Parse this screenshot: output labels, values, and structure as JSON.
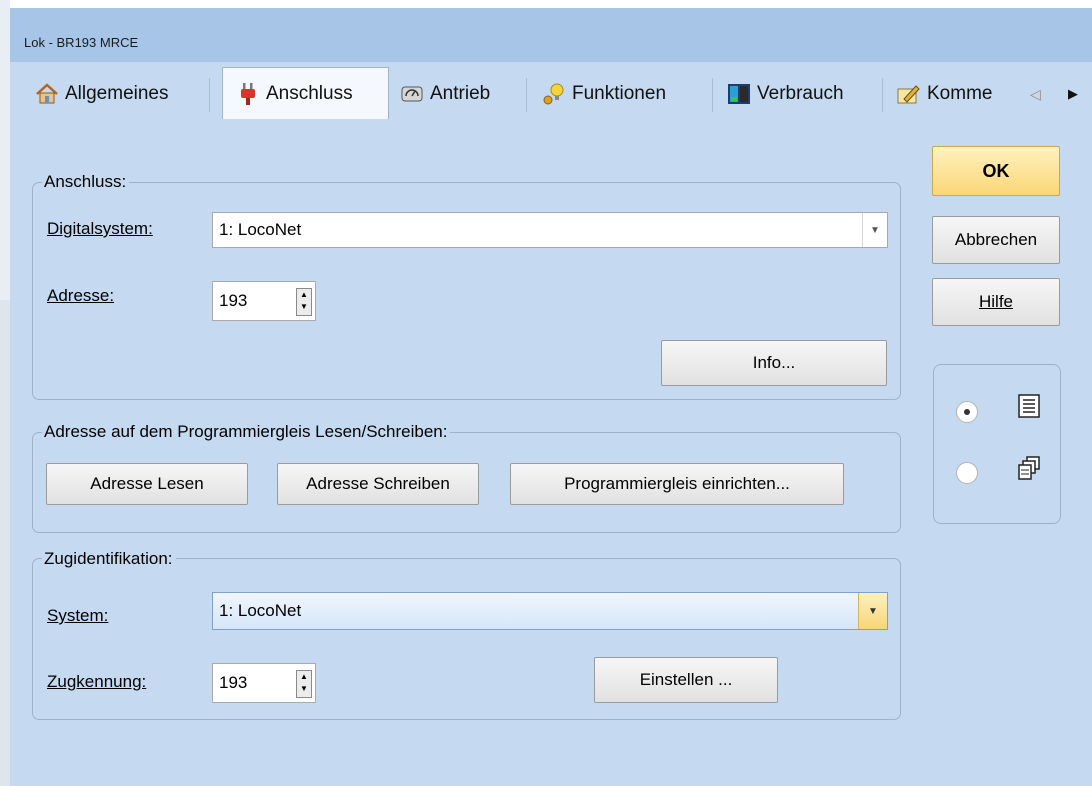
{
  "window": {
    "title": "Lok - BR193 MRCE"
  },
  "tabs": [
    {
      "label": "Allgemeines",
      "icon": "house-icon"
    },
    {
      "label": "Anschluss",
      "icon": "plug-icon"
    },
    {
      "label": "Antrieb",
      "icon": "engine-icon"
    },
    {
      "label": "Funktionen",
      "icon": "lightbulb-icon"
    },
    {
      "label": "Verbrauch",
      "icon": "meter-icon"
    },
    {
      "label": "Komme",
      "icon": "pencil-note-icon"
    }
  ],
  "tab_scroll": {
    "left": "◁",
    "right": "▶"
  },
  "anschluss": {
    "legend": "Anschluss:",
    "digitalsystem_label": "Digitalsystem:",
    "digitalsystem_value": "1: LocoNet",
    "adresse_label": "Adresse:",
    "adresse_value": "193",
    "info_button": "Info..."
  },
  "programmiergleis": {
    "legend": "Adresse auf dem Programmiergleis Lesen/Schreiben:",
    "lesen_button": "Adresse Lesen",
    "schreiben_button": "Adresse Schreiben",
    "einrichten_button": "Programmiergleis einrichten..."
  },
  "zugidentifikation": {
    "legend": "Zugidentifikation:",
    "system_label": "System:",
    "system_value": "1: LocoNet",
    "zugkennung_label": "Zugkennung:",
    "zugkennung_value": "193",
    "einstellen_button": "Einstellen ..."
  },
  "buttons": {
    "ok": "OK",
    "cancel": "Abbrechen",
    "help": "Hilfe"
  },
  "view_options": {
    "selected": "list-view",
    "options": [
      "list-view",
      "tile-view"
    ]
  },
  "colors": {
    "window_bg": "#c5daf0",
    "titlebar": "#a7c5e6",
    "ok_button": "#fde59a"
  }
}
